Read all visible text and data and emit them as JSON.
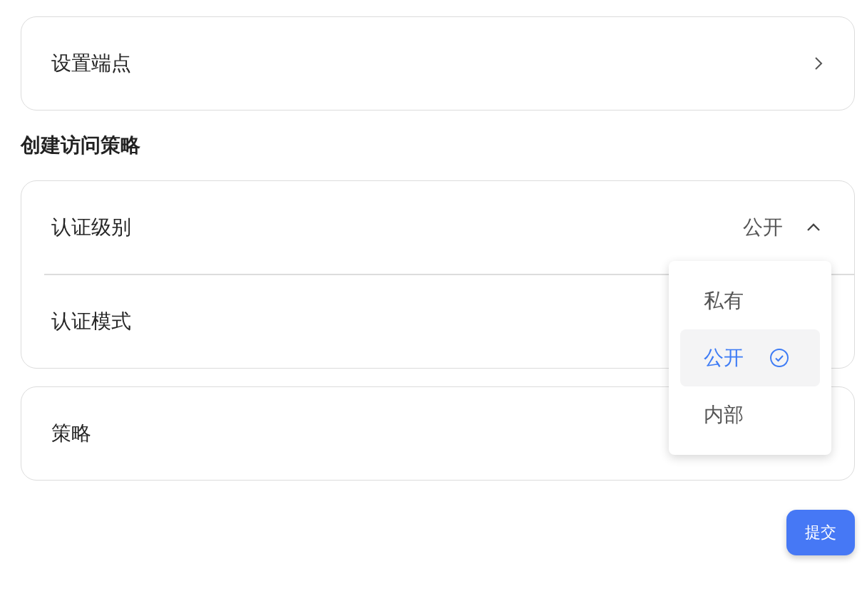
{
  "endpoint": {
    "label": "设置端点"
  },
  "heading": "创建访问策略",
  "auth_level": {
    "label": "认证级别",
    "value": "公开",
    "expanded": true
  },
  "auth_mode": {
    "label": "认证模式"
  },
  "policy": {
    "label": "策略"
  },
  "dropdown": {
    "options": [
      {
        "label": "私有",
        "selected": false
      },
      {
        "label": "公开",
        "selected": true
      },
      {
        "label": "内部",
        "selected": false
      }
    ]
  },
  "submit": "提交"
}
